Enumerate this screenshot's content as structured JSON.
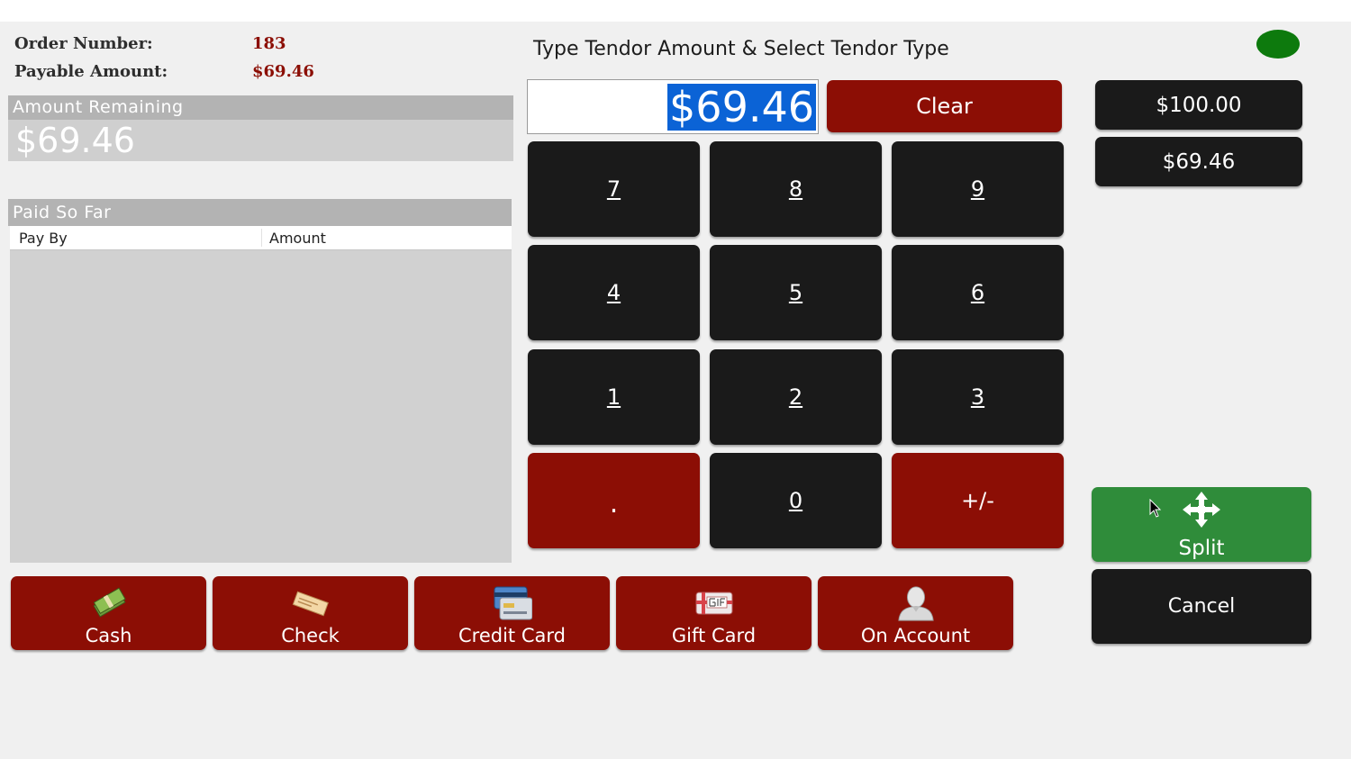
{
  "order": {
    "number_label": "Order Number:",
    "number_value": "183",
    "payable_label": "Payable Amount:",
    "payable_value": "$69.46"
  },
  "amount_remaining": {
    "header": "Amount Remaining",
    "value": "$69.46"
  },
  "paid_so_far": {
    "header": "Paid So Far",
    "columns": [
      "Pay By",
      "Amount"
    ],
    "rows": []
  },
  "tender": {
    "title": "Type Tendor Amount & Select Tendor Type",
    "input_value": "$69.46",
    "clear_label": "Clear"
  },
  "keypad": {
    "keys": [
      "7",
      "8",
      "9",
      "4",
      "5",
      "6",
      "1",
      "2",
      "3",
      ".",
      "0",
      "+/-"
    ]
  },
  "quick_amounts": [
    "$100.00",
    "$69.46"
  ],
  "tender_types": [
    {
      "label": "Cash",
      "icon": "cash-icon"
    },
    {
      "label": "Check",
      "icon": "check-icon"
    },
    {
      "label": "Credit Card",
      "icon": "credit-card-icon"
    },
    {
      "label": "Gift Card",
      "icon": "gift-card-icon"
    },
    {
      "label": "On Account",
      "icon": "account-person-icon"
    }
  ],
  "actions": {
    "split_label": "Split",
    "split_icon": "move-arrows-icon",
    "cancel_label": "Cancel"
  },
  "colors": {
    "accent_red": "#8c0e05",
    "dark_button": "#1a1a1a",
    "split_green": "#2f8c3a",
    "status_green": "#0d7a0d",
    "selection_blue": "#0b63d6"
  }
}
